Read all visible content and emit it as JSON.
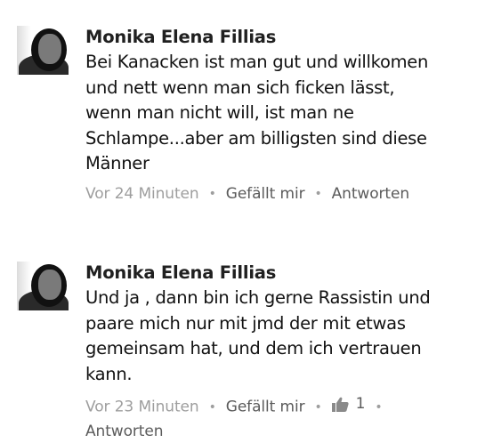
{
  "comments": [
    {
      "author": "Monika Elena Fillias",
      "lines": [
        "Bei Kanacken ist man gut und willkomen",
        "und nett wenn man sich ficken lässt,",
        "wenn man nicht will, ist man ne",
        "Schlampe...aber am billigsten sind diese",
        "Männer"
      ],
      "time": "Vor 24 Minuten",
      "like_label": "Gefällt mir",
      "reply_label": "Antworten"
    },
    {
      "author": "Monika Elena Fillias",
      "lines": [
        "Und ja , dann  bin ich gerne Rassistin und",
        "paare mich nur mit jmd der mit etwas",
        "gemeinsam hat, und dem ich vertrauen",
        "kann."
      ],
      "time": "Vor 23 Minuten",
      "like_label": "Gefällt mir",
      "like_count": "1",
      "like_icon": "thumbs-up-icon",
      "reply_label": "Antworten"
    }
  ],
  "separator": "•"
}
